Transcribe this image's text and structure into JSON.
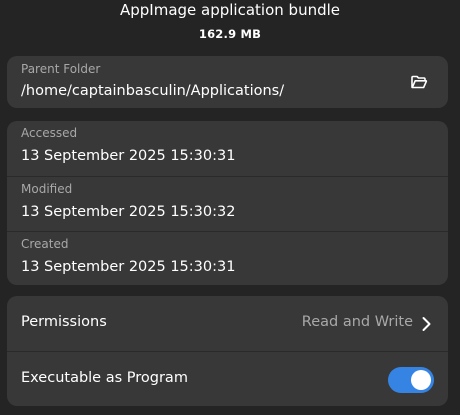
{
  "header": {
    "file_type": "AppImage application bundle",
    "file_size": "162.9 MB"
  },
  "location": {
    "label": "Parent Folder",
    "path": "/home/captainbasculin/Applications/",
    "open_icon": "folder-open-icon"
  },
  "dates": [
    {
      "label": "Accessed",
      "value": "13 September 2025 15:30:31"
    },
    {
      "label": "Modified",
      "value": "13 September 2025 15:30:32"
    },
    {
      "label": "Created",
      "value": "13 September 2025 15:30:31"
    }
  ],
  "permissions": {
    "label": "Permissions",
    "value": "Read and Write",
    "chevron_icon": "chevron-right-icon"
  },
  "executable": {
    "label": "Executable as Program",
    "enabled": true
  },
  "colors": {
    "background": "#242424",
    "card": "#383838",
    "accent": "#3584e4",
    "dim_text": "#a8a8a8"
  }
}
